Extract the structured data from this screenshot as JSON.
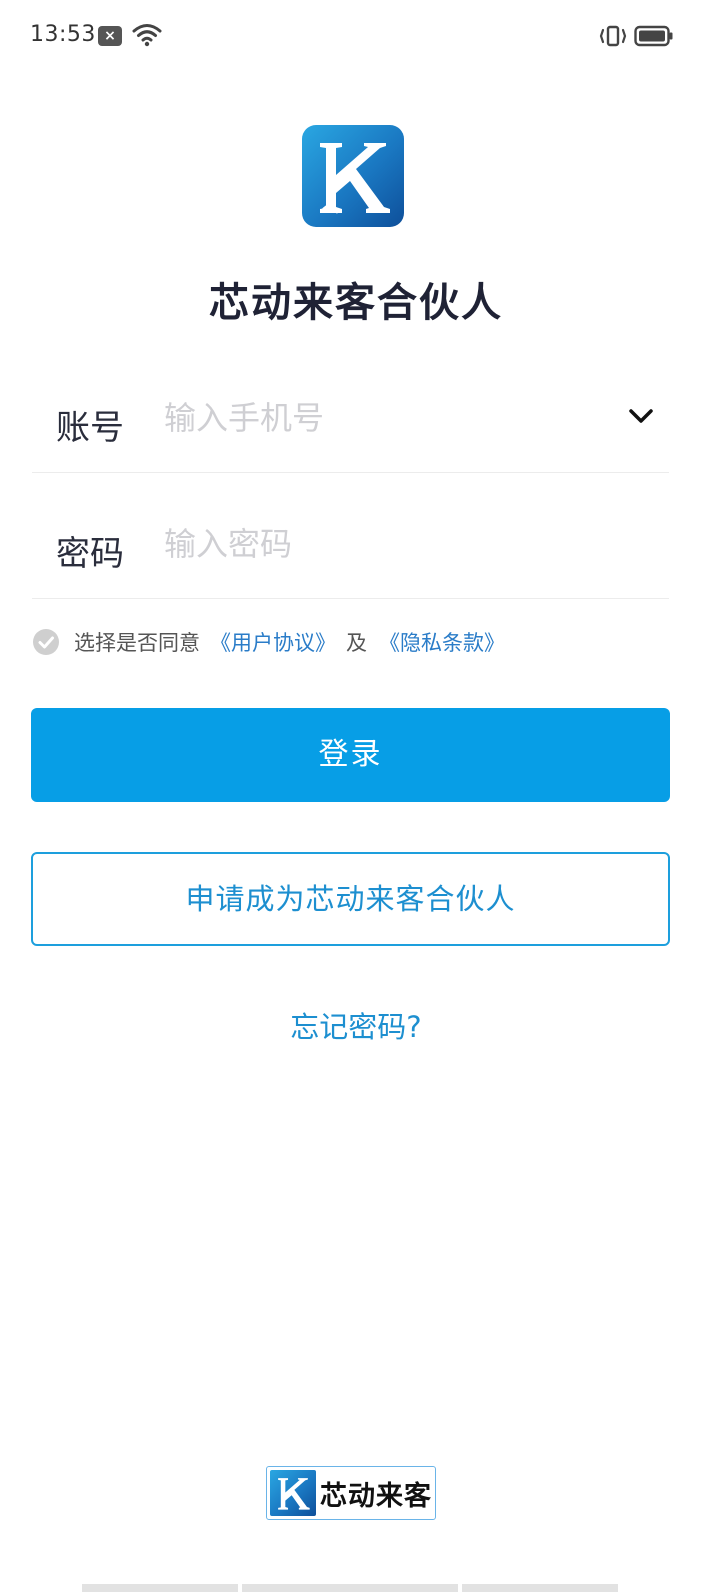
{
  "status_bar": {
    "time": "13:53",
    "notification_icon": "close-notification-icon",
    "wifi_icon": "wifi-icon",
    "vibrate_icon": "vibrate-icon",
    "battery_icon": "battery-icon"
  },
  "app": {
    "title": "芯动来客合伙人",
    "logo_letters": "K",
    "brand_colors": [
      "#2aa7e2",
      "#1a78c2",
      "#0e4f9a"
    ]
  },
  "form": {
    "account_label": "账号",
    "account_placeholder": "输入手机号",
    "password_label": "密码",
    "password_placeholder": "输入密码"
  },
  "agreement": {
    "text": "选择是否同意",
    "user_agreement": "《用户协议》",
    "joiner": "及",
    "privacy_policy": "《隐私条款》"
  },
  "actions": {
    "login_label": "登录",
    "apply_label": "申请成为芯动来客合伙人",
    "forgot_label": "忘记密码?"
  },
  "footer": {
    "brand_name": "芯动来客"
  },
  "colors": {
    "primary": "#079ee6",
    "link": "#1d8fd0",
    "title": "#1f2235",
    "placeholder": "#cfcfd3"
  }
}
